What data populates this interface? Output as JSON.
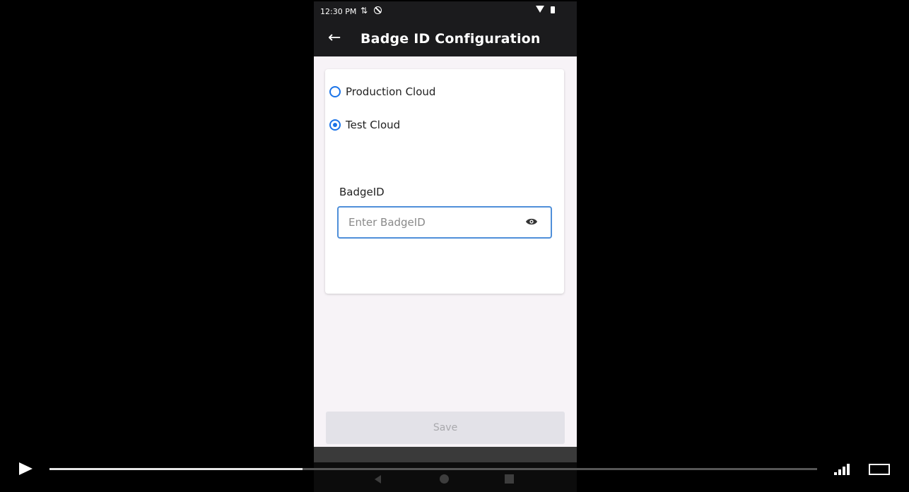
{
  "status_bar": {
    "time": "12:30 PM",
    "icons": [
      "usb-icon",
      "do-not-disturb-icon",
      "wifi-icon",
      "battery-icon"
    ]
  },
  "app_bar": {
    "back_icon": "←",
    "title": "Badge ID Configuration"
  },
  "form": {
    "environment_options": [
      {
        "label": "Production Cloud",
        "selected": false
      },
      {
        "label": "Test Cloud",
        "selected": true
      }
    ],
    "badge_field": {
      "label": "BadgeID",
      "placeholder": "Enter BadgeID",
      "value": ""
    },
    "save_label": "Save"
  },
  "player": {
    "progress": 0.33
  },
  "colors": {
    "accent": "#1a73e8",
    "app_bar": "#1b1b1d",
    "input_border": "#4f8fd9",
    "save_disabled_bg": "#e3e2e8",
    "save_disabled_text": "#a9a9ad"
  }
}
